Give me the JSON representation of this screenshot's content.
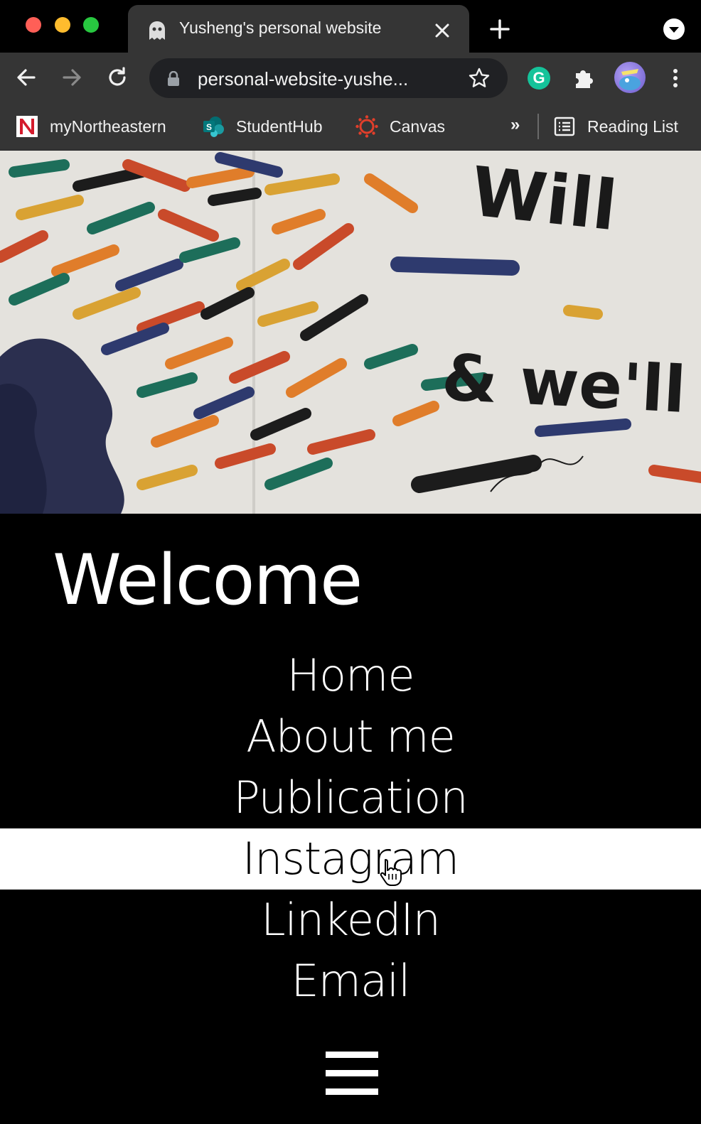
{
  "browser": {
    "tab_title": "Yusheng's personal website",
    "url": "personal-website-yushe...",
    "icons": {
      "tab": "ghost-icon",
      "close": "close-icon",
      "new_tab": "plus-icon",
      "tab_search": "chevron-down-icon",
      "back": "back-arrow-icon",
      "forward": "forward-arrow-icon",
      "reload": "reload-icon",
      "lock": "lock-icon",
      "star": "star-icon",
      "grammarly": "grammarly-icon",
      "extensions": "puzzle-icon",
      "menu": "kebab-menu-icon"
    },
    "grammarly_letter": "G",
    "bookmarks": [
      {
        "label": "myNortheastern",
        "icon": "northeastern-icon"
      },
      {
        "label": "StudentHub",
        "icon": "sharepoint-icon"
      },
      {
        "label": "Canvas",
        "icon": "canvas-icon"
      }
    ],
    "bookmarks_more": "»",
    "reading_list": "Reading List"
  },
  "page": {
    "heading": "Welcome",
    "nav": [
      {
        "label": "Home",
        "hovered": false
      },
      {
        "label": "About me",
        "hovered": false
      },
      {
        "label": "Publication",
        "hovered": false
      },
      {
        "label": "Instagram",
        "hovered": true
      },
      {
        "label": "LinkedIn",
        "hovered": false
      },
      {
        "label": "Email",
        "hovered": false
      }
    ],
    "menu_icon": "hamburger-icon",
    "hero_text": [
      "Will",
      "& we'll"
    ]
  },
  "colors": {
    "chrome": "#353535",
    "omnibox": "#202124",
    "page_bg": "#000000",
    "hover_bg": "#ffffff"
  }
}
